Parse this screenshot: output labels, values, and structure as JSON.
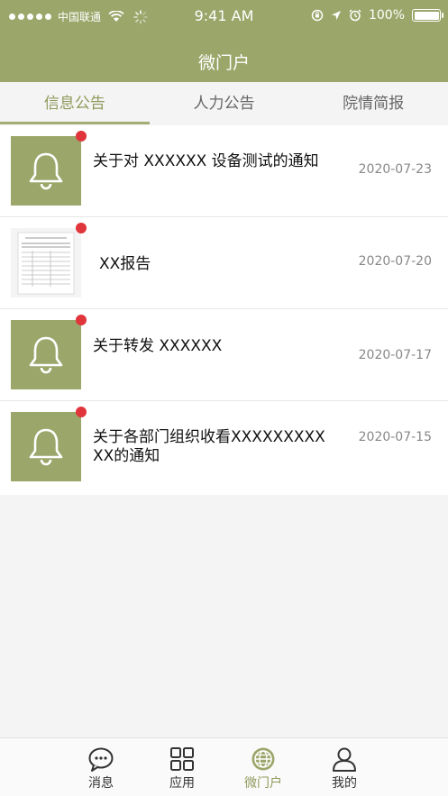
{
  "status": {
    "carrier": "中国联通",
    "time": "9:41 AM",
    "battery": "100%"
  },
  "nav": {
    "title": "微门户"
  },
  "tabs": [
    {
      "label": "信息公告",
      "active": true
    },
    {
      "label": "人力公告",
      "active": false
    },
    {
      "label": "院情简报",
      "active": false
    }
  ],
  "items": [
    {
      "title": "关于对   XXXXXX   设备测试的通知",
      "date": "2020-07-23",
      "icon": "bell-icon"
    },
    {
      "title": "XX报告",
      "date": "2020-07-20",
      "icon": "document-thumbnail"
    },
    {
      "title": "关于转发 XXXXXX",
      "date": "2020-07-17",
      "icon": "bell-icon"
    },
    {
      "title": "关于各部门组织收看XXXXXXXXXXX的通知",
      "date": "2020-07-15",
      "icon": "bell-icon"
    }
  ],
  "tabbar": [
    {
      "label": "消息",
      "icon": "chat-bubble-icon"
    },
    {
      "label": "应用",
      "icon": "grid-icon"
    },
    {
      "label": "微门户",
      "icon": "globe-icon",
      "active": true
    },
    {
      "label": "我的",
      "icon": "person-icon"
    }
  ],
  "colors": {
    "accent": "#9ba66a",
    "badge": "#e0353b"
  }
}
